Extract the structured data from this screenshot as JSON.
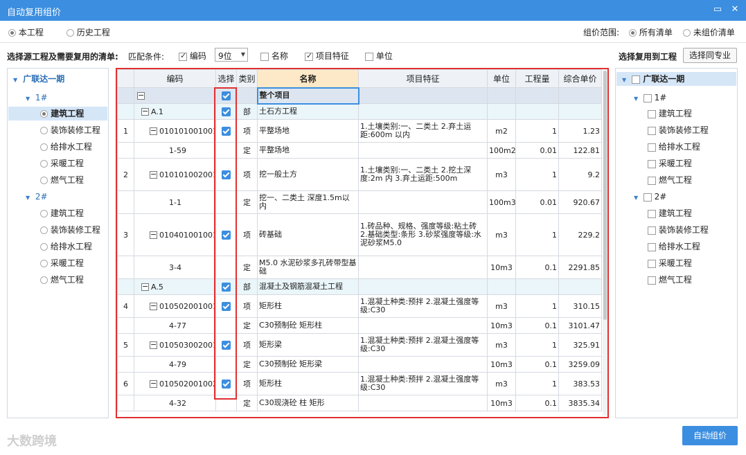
{
  "window": {
    "title": "自动复用组价",
    "min_icon": "▭",
    "close_icon": "✕"
  },
  "scope": {
    "this_project": "本工程",
    "history_project": "历史工程",
    "range_label": "组价范围:",
    "all_list": "所有清单",
    "unpriced_list": "未组价清单"
  },
  "match": {
    "source_label": "选择源工程及需要复用的清单:",
    "cond_label": "匹配条件:",
    "code": "编码",
    "digits": "9位",
    "name": "名称",
    "feature": "项目特征",
    "unit": "单位",
    "target_label": "选择复用到工程",
    "select_same_btn": "选择同专业"
  },
  "left_tree": {
    "root": "广联达一期",
    "nodes": [
      {
        "label": "1#",
        "items": [
          "建筑工程",
          "装饰装修工程",
          "给排水工程",
          "采暖工程",
          "燃气工程"
        ]
      },
      {
        "label": "2#",
        "items": [
          "建筑工程",
          "装饰装修工程",
          "给排水工程",
          "采暖工程",
          "燃气工程"
        ]
      }
    ]
  },
  "right_tree": {
    "root": "广联达一期",
    "nodes": [
      {
        "label": "1#",
        "items": [
          "建筑工程",
          "装饰装修工程",
          "给排水工程",
          "采暖工程",
          "燃气工程"
        ]
      },
      {
        "label": "2#",
        "items": [
          "建筑工程",
          "装饰装修工程",
          "给排水工程",
          "采暖工程",
          "燃气工程"
        ]
      }
    ]
  },
  "grid": {
    "headers": [
      "",
      "编码",
      "选择",
      "类别",
      "名称",
      "项目特征",
      "单位",
      "工程量",
      "综合单价"
    ],
    "rows": [
      {
        "no": "",
        "code": "",
        "type": "",
        "name": "整个项目",
        "feature": "",
        "unit": "",
        "qty": "",
        "price": ""
      },
      {
        "no": "",
        "code": "A.1",
        "type": "部",
        "name": "土石方工程",
        "feature": "",
        "unit": "",
        "qty": "",
        "price": ""
      },
      {
        "no": "1",
        "code": "010101001001",
        "type": "项",
        "name": "平整场地",
        "feature": "1.土壤类别:一、二类土\n2.弃土运距:600m 以内",
        "unit": "m2",
        "qty": "1",
        "price": "1.23"
      },
      {
        "no": "",
        "code": "1-59",
        "type": "定",
        "name": "平整场地",
        "feature": "",
        "unit": "100m2",
        "qty": "0.01",
        "price": "122.81"
      },
      {
        "no": "2",
        "code": "010101002001",
        "type": "项",
        "name": "挖一般土方",
        "feature": "1.土壤类别:一、二类土\n2.挖土深度:2m 内\n3.弃土运距:500m",
        "unit": "m3",
        "qty": "1",
        "price": "9.2"
      },
      {
        "no": "",
        "code": "1-1",
        "type": "定",
        "name": "挖一、二类土 深度1.5m以内",
        "feature": "",
        "unit": "100m3",
        "qty": "0.01",
        "price": "920.67"
      },
      {
        "no": "3",
        "code": "010401001001",
        "type": "项",
        "name": "砖基础",
        "feature": "1.砖品种、规格、强度等级:粘土砖\n2.基础类型:条形\n3.砂浆强度等级:水泥砂浆M5.0",
        "unit": "m3",
        "qty": "1",
        "price": "229.2"
      },
      {
        "no": "",
        "code": "3-4",
        "type": "定",
        "name": "M5.0 水泥砂浆多孔砖带型基础",
        "feature": "",
        "unit": "10m3",
        "qty": "0.1",
        "price": "2291.85"
      },
      {
        "no": "",
        "code": "A.5",
        "type": "部",
        "name": "混凝土及钢筋混凝土工程",
        "feature": "",
        "unit": "",
        "qty": "",
        "price": ""
      },
      {
        "no": "4",
        "code": "010502001001",
        "type": "项",
        "name": "矩形柱",
        "feature": "1.混凝土种类:预拌\n2.混凝土强度等级:C30",
        "unit": "m3",
        "qty": "1",
        "price": "310.15"
      },
      {
        "no": "",
        "code": "4-77",
        "type": "定",
        "name": "C30预制砼 矩形柱",
        "feature": "",
        "unit": "10m3",
        "qty": "0.1",
        "price": "3101.47"
      },
      {
        "no": "5",
        "code": "010503002001",
        "type": "项",
        "name": "矩形梁",
        "feature": "1.混凝土种类:预拌\n2.混凝土强度等级:C30",
        "unit": "m3",
        "qty": "1",
        "price": "325.91"
      },
      {
        "no": "",
        "code": "4-79",
        "type": "定",
        "name": "C30预制砼 矩形梁",
        "feature": "",
        "unit": "10m3",
        "qty": "0.1",
        "price": "3259.09"
      },
      {
        "no": "6",
        "code": "010502001002",
        "type": "项",
        "name": "矩形柱",
        "feature": "1.混凝土种类:预拌\n2.混凝土强度等级:C30",
        "unit": "m3",
        "qty": "1",
        "price": "383.53"
      },
      {
        "no": "",
        "code": "4-32",
        "type": "定",
        "name": "C30现浇砼 柱 矩形",
        "feature": "",
        "unit": "10m3",
        "qty": "0.1",
        "price": "3835.34"
      }
    ]
  },
  "footer": {
    "auto_price_btn": "自动组价",
    "watermark": "大数跨境"
  }
}
